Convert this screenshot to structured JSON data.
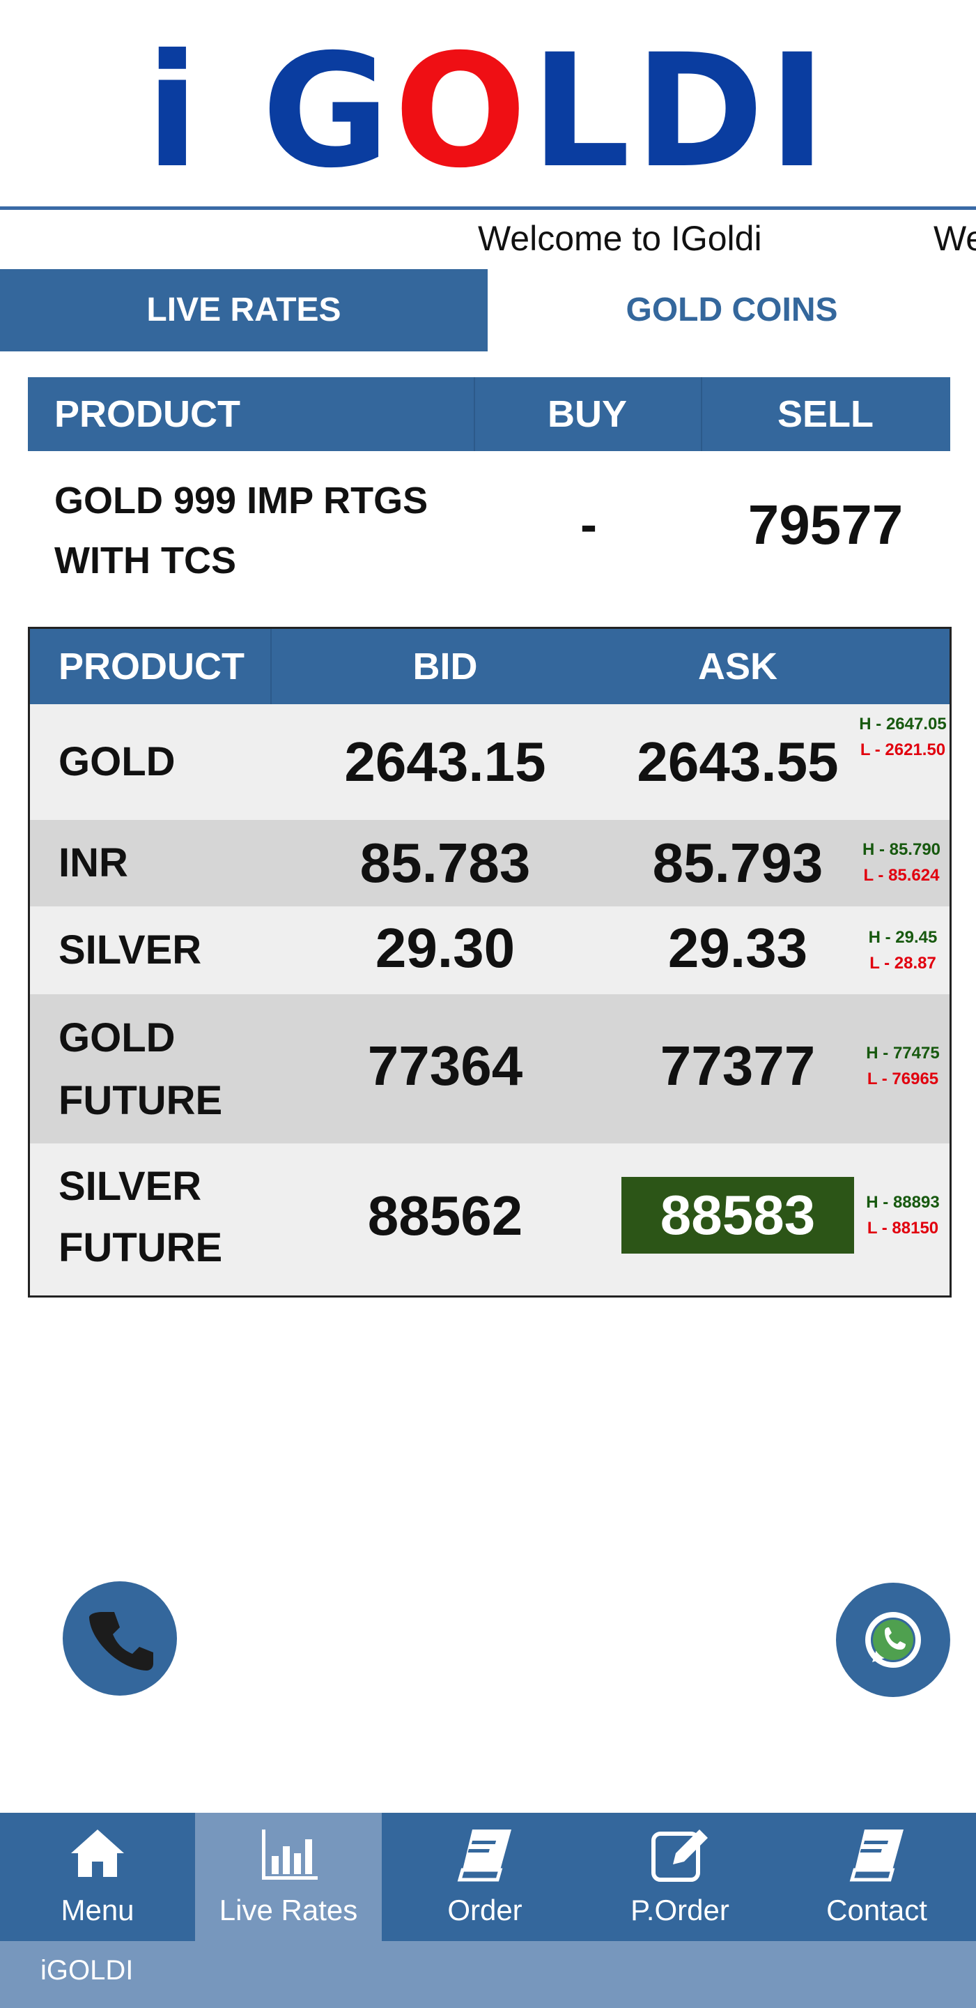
{
  "brand": {
    "logo_prefix": "i G",
    "logo_o": "O",
    "logo_suffix": "LDI",
    "primary_color": "#34679c",
    "logo_blue": "#0a3da0",
    "logo_red": "#ef0f14"
  },
  "marquee": {
    "text": "Welcome to IGoldi",
    "text_repeat": "We"
  },
  "tabs": [
    {
      "label": "LIVE RATES",
      "active": true
    },
    {
      "label": "GOLD COINS",
      "active": false
    }
  ],
  "rtgs_table": {
    "headers": [
      "PRODUCT",
      "BUY",
      "SELL"
    ],
    "rows": [
      {
        "product_line1": "GOLD 999 IMP RTGS",
        "product_line2": "WITH TCS",
        "buy": "-",
        "sell": "79577"
      }
    ]
  },
  "spot_table": {
    "headers": [
      "PRODUCT",
      "BID",
      "ASK"
    ],
    "rows": [
      {
        "product": "GOLD",
        "bid": "2643.15",
        "ask": "2643.55",
        "high": "H - 2647.05",
        "low": "L - 2621.50",
        "ask_highlight": false
      },
      {
        "product": "INR",
        "bid": "85.783",
        "ask": "85.793",
        "high": "H - 85.790",
        "low": "L - 85.624",
        "ask_highlight": false
      },
      {
        "product": "SILVER",
        "bid": "29.30",
        "ask": "29.33",
        "high": "H - 29.45",
        "low": "L - 28.87",
        "ask_highlight": false
      },
      {
        "product_line1": "GOLD",
        "product_line2": "FUTURE",
        "bid": "77364",
        "ask": "77377",
        "high": "H - 77475",
        "low": "L - 76965",
        "ask_highlight": false
      },
      {
        "product_line1": "SILVER",
        "product_line2": "FUTURE",
        "bid": "88562",
        "ask": "88583",
        "high": "H - 88893",
        "low": "L - 88150",
        "ask_highlight": true
      }
    ]
  },
  "fabs": {
    "call_icon": "phone-icon",
    "whatsapp_icon": "whatsapp-icon"
  },
  "bottom_nav": [
    {
      "label": "Menu",
      "icon": "home-icon",
      "active": false
    },
    {
      "label": "Live Rates",
      "icon": "bar-chart-icon",
      "active": true
    },
    {
      "label": "Order",
      "icon": "book-icon",
      "active": false
    },
    {
      "label": "P.Order",
      "icon": "edit-icon",
      "active": false
    },
    {
      "label": "Contact",
      "icon": "book-icon",
      "active": false
    }
  ],
  "footer": {
    "text": "iGOLDI"
  }
}
